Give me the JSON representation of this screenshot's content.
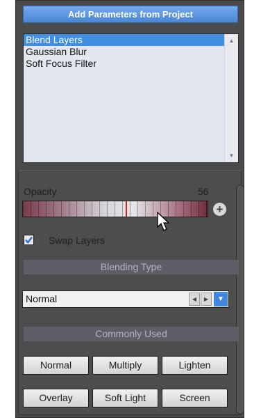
{
  "header": {
    "title": "Add Parameters from Project"
  },
  "list": {
    "items": [
      {
        "label": "Blend Layers",
        "selected": true
      },
      {
        "label": "Gaussian Blur",
        "selected": false
      },
      {
        "label": "Soft Focus Filter",
        "selected": false
      }
    ]
  },
  "opacity": {
    "label": "Opacity",
    "value": "56"
  },
  "swap": {
    "label": "Swap Layers",
    "checked": true
  },
  "blending": {
    "header": "Blending Type",
    "selected": "Normal"
  },
  "common": {
    "header": "Commonly Used",
    "buttons": [
      {
        "label": "Normal"
      },
      {
        "label": "Multiply"
      },
      {
        "label": "Lighten"
      },
      {
        "label": "Overlay"
      },
      {
        "label": "Soft Light"
      },
      {
        "label": "Screen"
      }
    ]
  },
  "colors": {
    "accent": "#3f8ee0",
    "panel": "#4a4a4a",
    "marker": "#e02020"
  }
}
